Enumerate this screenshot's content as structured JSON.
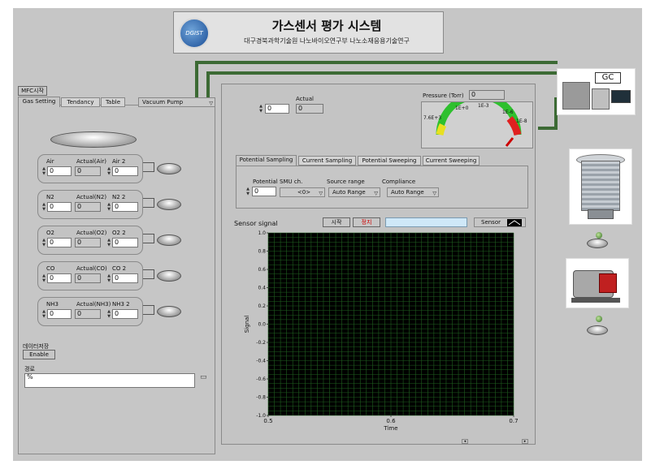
{
  "header": {
    "logo_text": "DGIST",
    "title": "가스센서 평가 시스템",
    "subtitle": "대구경북과학기술원 나노바이오연구부 나노소재응용기술연구"
  },
  "left": {
    "mfc_button": "MFC시작",
    "tabs": [
      "Gas Setting",
      "Tendancy",
      "Table"
    ],
    "vacuum_dropdown": "Vacuum Pump",
    "gases": [
      {
        "name": "Air",
        "actual_label": "Actual(Air)",
        "set2_label": "Air 2",
        "value": "0",
        "actual": "0",
        "value2": "0"
      },
      {
        "name": "N2",
        "actual_label": "Actual(N2)",
        "set2_label": "N2 2",
        "value": "0",
        "actual": "0",
        "value2": "0"
      },
      {
        "name": "O2",
        "actual_label": "Actual(O2)",
        "set2_label": "O2 2",
        "value": "0",
        "actual": "0",
        "value2": "0"
      },
      {
        "name": "CO",
        "actual_label": "Actual(CO)",
        "set2_label": "CO 2",
        "value": "0",
        "actual": "0",
        "value2": "0"
      },
      {
        "name": "NH3",
        "actual_label": "Actual(NH3)",
        "set2_label": "NH3 2",
        "value": "0",
        "actual": "0",
        "value2": "0"
      }
    ],
    "save_label": "데이터저장",
    "enable_button": "Enable",
    "path_label": "경로",
    "path_value": "%"
  },
  "main": {
    "actual_label": "Actual",
    "set_value": "0",
    "actual_value": "0",
    "pressure_label": "Pressure (Torr)",
    "pressure_value": "0",
    "gauge_ticks": [
      "7.6E+3",
      "1E+0",
      "1E-3",
      "1E-6",
      "1E-8"
    ],
    "sub_tabs": [
      "Potential Sampling",
      "Current Sampling",
      "Potential Sweeping",
      "Current Sweeping"
    ],
    "potential_label": "Potential",
    "smu_label": "SMU ch.",
    "source_range_label": "Source range",
    "compliance_label": "Compliance",
    "potential_value": "0",
    "smu_value": "<0>",
    "source_range_value": "Auto Range",
    "compliance_value": "Auto Range",
    "start_button": "시작",
    "stop_button": "정지",
    "sensor_legend": "Sensor"
  },
  "chart_data": {
    "type": "line",
    "title": "Sensor signal",
    "xlabel": "Time",
    "ylabel": "Signal",
    "xlim": [
      0.5,
      0.7
    ],
    "ylim": [
      -1.0,
      1.0
    ],
    "x_ticks": [
      "0.5",
      "0.6",
      "0.7"
    ],
    "y_ticks": [
      "1.0",
      "0.8",
      "0.6",
      "0.4",
      "0.2",
      "0.0",
      "-0.2",
      "-0.4",
      "-0.6",
      "-0.8",
      "-1.0"
    ],
    "grid": true,
    "series": []
  },
  "right": {
    "gc_label": "GC"
  },
  "colors": {
    "panel": "#c6c6c6",
    "plot_bg": "#000000",
    "grid": "#1f5f1f",
    "pipe": "#3c6a34",
    "gauge_green": "#2ec02e",
    "gauge_red": "#e02020",
    "stop_text": "#d00000",
    "status_field": "#cfe8f8"
  }
}
